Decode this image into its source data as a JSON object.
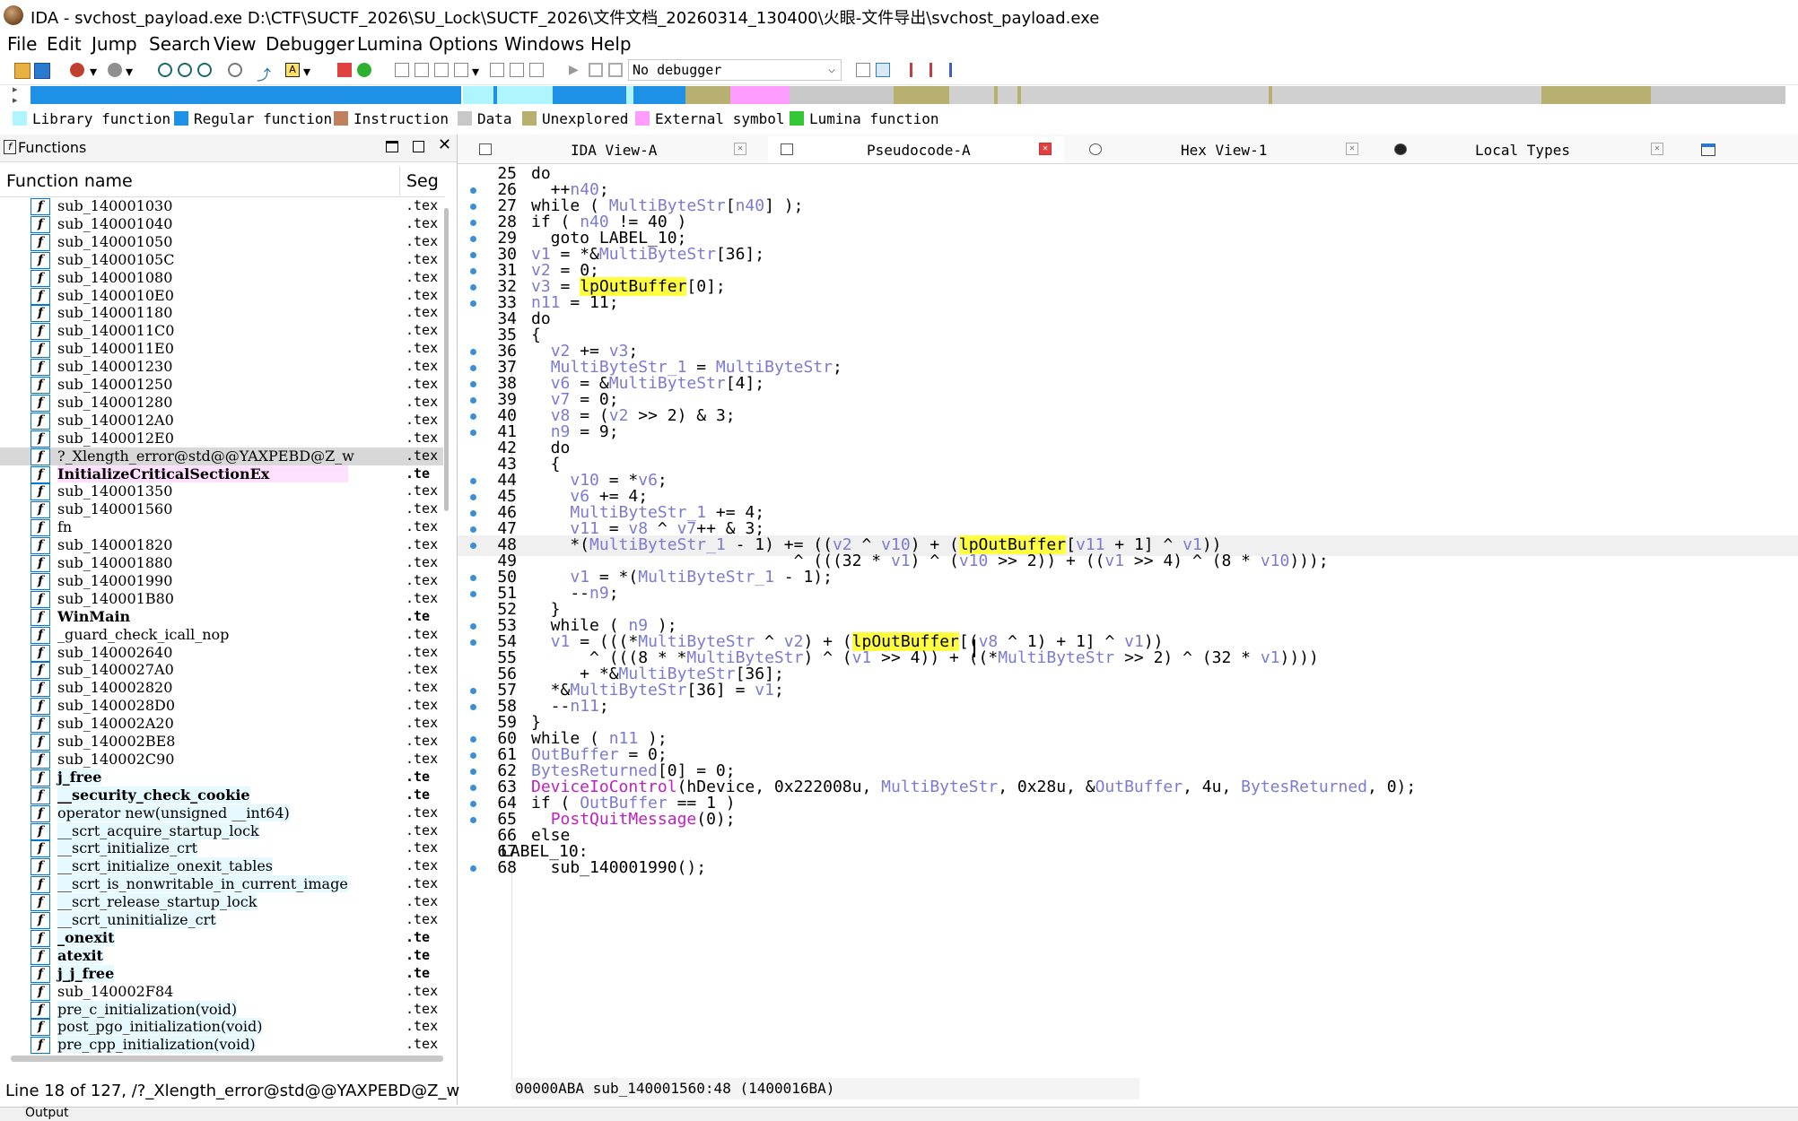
{
  "window": {
    "title": "IDA - svchost_payload.exe D:\\CTF\\SUCTF_2026\\SU_Lock\\SUCTF_2026\\文件文档_20260314_130400\\火眼-文件导出\\svchost_payload.exe"
  },
  "menu": [
    "File",
    "Edit",
    "Jump",
    "Search",
    "View",
    "Debugger",
    "Lumina",
    "Options",
    "Windows",
    "Help"
  ],
  "toolbar": {
    "debugger_select": "No debugger"
  },
  "legend": [
    {
      "label": "Library function",
      "color": "#aef5ff"
    },
    {
      "label": "Regular function",
      "color": "#1e90e6"
    },
    {
      "label": "Instruction",
      "color": "#c08060"
    },
    {
      "label": "Data",
      "color": "#c8c8c8"
    },
    {
      "label": "Unexplored",
      "color": "#b8b070"
    },
    {
      "label": "External symbol",
      "color": "#ff9cff"
    },
    {
      "label": "Lumina function",
      "color": "#34c934"
    }
  ],
  "functions_panel": {
    "title": "Functions",
    "col_name": "Function name",
    "col_seg": "Seg",
    "status": "Line 18 of 127, /?_Xlength_error@std@@YAXPEBD@Z_w",
    "rows": [
      {
        "name": "sub_140001030",
        "seg": ".tex",
        "kind": "reg"
      },
      {
        "name": "sub_140001040",
        "seg": ".tex",
        "kind": "reg"
      },
      {
        "name": "sub_140001050",
        "seg": ".tex",
        "kind": "reg"
      },
      {
        "name": "sub_14000105C",
        "seg": ".tex",
        "kind": "reg"
      },
      {
        "name": "sub_140001080",
        "seg": ".tex",
        "kind": "reg"
      },
      {
        "name": "sub_1400010E0",
        "seg": ".tex",
        "kind": "reg"
      },
      {
        "name": "sub_140001180",
        "seg": ".tex",
        "kind": "reg"
      },
      {
        "name": "sub_1400011C0",
        "seg": ".tex",
        "kind": "reg"
      },
      {
        "name": "sub_1400011E0",
        "seg": ".tex",
        "kind": "reg"
      },
      {
        "name": "sub_140001230",
        "seg": ".tex",
        "kind": "reg"
      },
      {
        "name": "sub_140001250",
        "seg": ".tex",
        "kind": "reg"
      },
      {
        "name": "sub_140001280",
        "seg": ".tex",
        "kind": "reg"
      },
      {
        "name": "sub_1400012A0",
        "seg": ".tex",
        "kind": "reg"
      },
      {
        "name": "sub_1400012E0",
        "seg": ".tex",
        "kind": "reg"
      },
      {
        "name": "?_Xlength_error@std@@YAXPEBD@Z_w",
        "seg": ".tex",
        "kind": "sel"
      },
      {
        "name": "InitializeCriticalSectionEx",
        "seg": ".te",
        "kind": "ext"
      },
      {
        "name": "sub_140001350",
        "seg": ".tex",
        "kind": "reg"
      },
      {
        "name": "sub_140001560",
        "seg": ".tex",
        "kind": "reg"
      },
      {
        "name": "fn",
        "seg": ".tex",
        "kind": "reg"
      },
      {
        "name": "sub_140001820",
        "seg": ".tex",
        "kind": "reg"
      },
      {
        "name": "sub_140001880",
        "seg": ".tex",
        "kind": "reg"
      },
      {
        "name": "sub_140001990",
        "seg": ".tex",
        "kind": "reg"
      },
      {
        "name": "sub_140001B80",
        "seg": ".tex",
        "kind": "reg"
      },
      {
        "name": "WinMain",
        "seg": ".te",
        "kind": "bold"
      },
      {
        "name": "_guard_check_icall_nop",
        "seg": ".tex",
        "kind": "reg"
      },
      {
        "name": "sub_140002640",
        "seg": ".tex",
        "kind": "reg"
      },
      {
        "name": "sub_1400027A0",
        "seg": ".tex",
        "kind": "reg"
      },
      {
        "name": "sub_140002820",
        "seg": ".tex",
        "kind": "reg"
      },
      {
        "name": "sub_1400028D0",
        "seg": ".tex",
        "kind": "reg"
      },
      {
        "name": "sub_140002A20",
        "seg": ".tex",
        "kind": "reg"
      },
      {
        "name": "sub_140002BE8",
        "seg": ".tex",
        "kind": "reg"
      },
      {
        "name": "sub_140002C90",
        "seg": ".tex",
        "kind": "reg"
      },
      {
        "name": "j_free",
        "seg": ".te",
        "kind": "libbold"
      },
      {
        "name": "__security_check_cookie",
        "seg": ".te",
        "kind": "libbold"
      },
      {
        "name": "operator new(unsigned __int64)",
        "seg": ".tex",
        "kind": "lib"
      },
      {
        "name": "__scrt_acquire_startup_lock",
        "seg": ".tex",
        "kind": "lib"
      },
      {
        "name": "__scrt_initialize_crt",
        "seg": ".tex",
        "kind": "lib"
      },
      {
        "name": "__scrt_initialize_onexit_tables",
        "seg": ".tex",
        "kind": "lib"
      },
      {
        "name": "__scrt_is_nonwritable_in_current_image",
        "seg": ".tex",
        "kind": "lib"
      },
      {
        "name": "__scrt_release_startup_lock",
        "seg": ".tex",
        "kind": "lib"
      },
      {
        "name": "__scrt_uninitialize_crt",
        "seg": ".tex",
        "kind": "lib"
      },
      {
        "name": "_onexit",
        "seg": ".te",
        "kind": "libbold"
      },
      {
        "name": "atexit",
        "seg": ".te",
        "kind": "libbold"
      },
      {
        "name": "j_j_free",
        "seg": ".te",
        "kind": "libbold"
      },
      {
        "name": "sub_140002F84",
        "seg": ".tex",
        "kind": "reg"
      },
      {
        "name": "pre_c_initialization(void)",
        "seg": ".tex",
        "kind": "lib"
      },
      {
        "name": "post_pgo_initialization(void)",
        "seg": ".tex",
        "kind": "lib"
      },
      {
        "name": "pre_cpp_initialization(void)",
        "seg": ".tex",
        "kind": "lib"
      }
    ]
  },
  "tabs": [
    {
      "label": "IDA View-A"
    },
    {
      "label": "Pseudocode-A",
      "active": true
    },
    {
      "label": "Hex View-1"
    },
    {
      "label": "Local Types"
    }
  ],
  "code": {
    "status": "00000ABA sub_140001560:48 (1400016BA)",
    "lines": [
      {
        "n": "25",
        "dot": false,
        "t": "do"
      },
      {
        "n": "26",
        "dot": true,
        "t": "  ++n40;"
      },
      {
        "n": "27",
        "dot": true,
        "t": "while ( MultiByteStr[n40] );"
      },
      {
        "n": "28",
        "dot": true,
        "t": "if ( n40 != 40 )"
      },
      {
        "n": "29",
        "dot": true,
        "t": "  goto LABEL_10;"
      },
      {
        "n": "30",
        "dot": true,
        "t": "v1 = *&MultiByteStr[36];"
      },
      {
        "n": "31",
        "dot": true,
        "t": "v2 = 0;"
      },
      {
        "n": "32",
        "dot": true,
        "t": "v3 = lpOutBuffer[0];"
      },
      {
        "n": "33",
        "dot": true,
        "t": "n11 = 11;"
      },
      {
        "n": "34",
        "dot": false,
        "t": "do"
      },
      {
        "n": "35",
        "dot": false,
        "t": "{"
      },
      {
        "n": "36",
        "dot": true,
        "t": "  v2 += v3;"
      },
      {
        "n": "37",
        "dot": true,
        "t": "  MultiByteStr_1 = MultiByteStr;"
      },
      {
        "n": "38",
        "dot": true,
        "t": "  v6 = &MultiByteStr[4];"
      },
      {
        "n": "39",
        "dot": true,
        "t": "  v7 = 0;"
      },
      {
        "n": "40",
        "dot": true,
        "t": "  v8 = (v2 >> 2) & 3;"
      },
      {
        "n": "41",
        "dot": true,
        "t": "  n9 = 9;"
      },
      {
        "n": "42",
        "dot": false,
        "t": "  do"
      },
      {
        "n": "43",
        "dot": false,
        "t": "  {"
      },
      {
        "n": "44",
        "dot": true,
        "t": "    v10 = *v6;"
      },
      {
        "n": "45",
        "dot": true,
        "t": "    v6 += 4;"
      },
      {
        "n": "46",
        "dot": true,
        "t": "    MultiByteStr_1 += 4;"
      },
      {
        "n": "47",
        "dot": true,
        "t": "    v11 = v8 ^ v7++ & 3;"
      },
      {
        "n": "48",
        "dot": true,
        "t": "    *(MultiByteStr_1 - 1) += ((v2 ^ v10) + (lpOutBuffer[v11 + 1] ^ v1))",
        "hl": true
      },
      {
        "n": "49",
        "dot": false,
        "t": "                           ^ (((32 * v1) ^ (v10 >> 2)) + ((v1 >> 4) ^ (8 * v10)));"
      },
      {
        "n": "50",
        "dot": true,
        "t": "    v1 = *(MultiByteStr_1 - 1);"
      },
      {
        "n": "51",
        "dot": true,
        "t": "    --n9;"
      },
      {
        "n": "52",
        "dot": false,
        "t": "  }"
      },
      {
        "n": "53",
        "dot": true,
        "t": "  while ( n9 );"
      },
      {
        "n": "54",
        "dot": true,
        "t": "  v1 = (((*MultiByteStr ^ v2) + (lpOutBuffer[(v8 ^ 1) + 1] ^ v1))"
      },
      {
        "n": "55",
        "dot": false,
        "t": "      ^ (((8 * *MultiByteStr) ^ (v1 >> 4)) + ((*MultiByteStr >> 2) ^ (32 * v1))))"
      },
      {
        "n": "56",
        "dot": false,
        "t": "     + *&MultiByteStr[36];"
      },
      {
        "n": "57",
        "dot": true,
        "t": "  *&MultiByteStr[36] = v1;"
      },
      {
        "n": "58",
        "dot": true,
        "t": "  --n11;"
      },
      {
        "n": "59",
        "dot": false,
        "t": "}"
      },
      {
        "n": "60",
        "dot": true,
        "t": "while ( n11 );"
      },
      {
        "n": "61",
        "dot": true,
        "t": "OutBuffer = 0;"
      },
      {
        "n": "62",
        "dot": true,
        "t": "BytesReturned[0] = 0;"
      },
      {
        "n": "63",
        "dot": true,
        "t": "DeviceIoControl(hDevice, 0x222008u, MultiByteStr, 0x28u, &OutBuffer, 4u, BytesReturned, 0);"
      },
      {
        "n": "64",
        "dot": true,
        "t": "if ( OutBuffer == 1 )"
      },
      {
        "n": "65",
        "dot": true,
        "t": "  PostQuitMessage(0);"
      },
      {
        "n": "66",
        "dot": false,
        "t": "else"
      },
      {
        "n": "67",
        "dot": false,
        "t": "LABEL_10:",
        "label": true
      },
      {
        "n": "68",
        "dot": true,
        "t": "  sub_140001990();"
      }
    ]
  },
  "output": {
    "label": "Output"
  }
}
